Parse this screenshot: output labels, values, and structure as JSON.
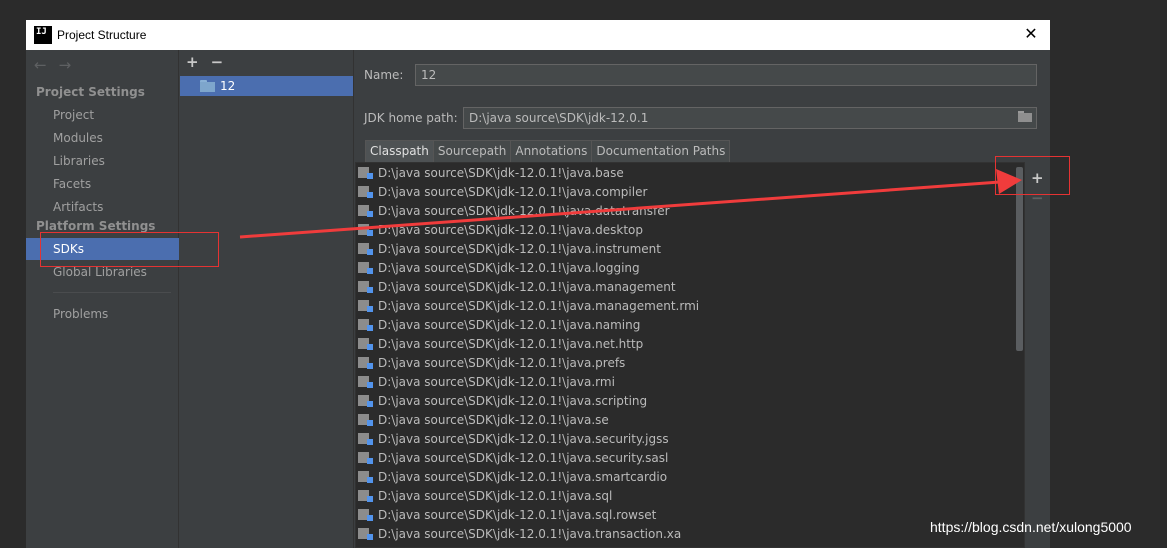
{
  "window": {
    "title": "Project Structure",
    "logo_text": "IJ",
    "close": "✕"
  },
  "nav": {
    "back": "←",
    "forward": "→",
    "sections": [
      {
        "header": "Project Settings",
        "items": [
          "Project",
          "Modules",
          "Libraries",
          "Facets",
          "Artifacts"
        ]
      },
      {
        "header": "Platform Settings",
        "items": [
          "SDKs",
          "Global Libraries"
        ]
      }
    ],
    "extra_items": [
      "Problems"
    ],
    "selected": "SDKs"
  },
  "sdk_list": {
    "add": "+",
    "remove": "−",
    "items": [
      "12"
    ]
  },
  "detail": {
    "name_label": "Name:",
    "name_value": "12",
    "jdk_label": "JDK home path:",
    "jdk_value": "D:\\java source\\SDK\\jdk-12.0.1",
    "tabs": [
      "Classpath",
      "Sourcepath",
      "Annotations",
      "Documentation Paths"
    ],
    "active_tab": "Classpath",
    "classpath": [
      "D:\\java source\\SDK\\jdk-12.0.1!\\java.base",
      "D:\\java source\\SDK\\jdk-12.0.1!\\java.compiler",
      "D:\\java source\\SDK\\jdk-12.0.1!\\java.datatransfer",
      "D:\\java source\\SDK\\jdk-12.0.1!\\java.desktop",
      "D:\\java source\\SDK\\jdk-12.0.1!\\java.instrument",
      "D:\\java source\\SDK\\jdk-12.0.1!\\java.logging",
      "D:\\java source\\SDK\\jdk-12.0.1!\\java.management",
      "D:\\java source\\SDK\\jdk-12.0.1!\\java.management.rmi",
      "D:\\java source\\SDK\\jdk-12.0.1!\\java.naming",
      "D:\\java source\\SDK\\jdk-12.0.1!\\java.net.http",
      "D:\\java source\\SDK\\jdk-12.0.1!\\java.prefs",
      "D:\\java source\\SDK\\jdk-12.0.1!\\java.rmi",
      "D:\\java source\\SDK\\jdk-12.0.1!\\java.scripting",
      "D:\\java source\\SDK\\jdk-12.0.1!\\java.se",
      "D:\\java source\\SDK\\jdk-12.0.1!\\java.security.jgss",
      "D:\\java source\\SDK\\jdk-12.0.1!\\java.security.sasl",
      "D:\\java source\\SDK\\jdk-12.0.1!\\java.smartcardio",
      "D:\\java source\\SDK\\jdk-12.0.1!\\java.sql",
      "D:\\java source\\SDK\\jdk-12.0.1!\\java.sql.rowset",
      "D:\\java source\\SDK\\jdk-12.0.1!\\java.transaction.xa"
    ],
    "side_add": "+",
    "side_remove": "−"
  },
  "annotation": {
    "color": "#e53333"
  },
  "watermark": "https://blog.csdn.net/xulong5000"
}
